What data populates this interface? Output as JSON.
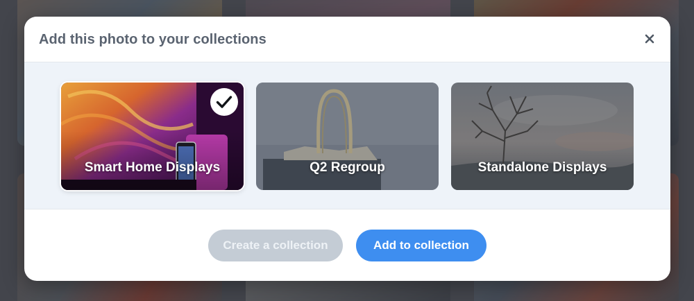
{
  "modal": {
    "title": "Add this photo to your collections",
    "close_icon": "close-icon"
  },
  "collections": [
    {
      "label": "Smart Home Displays",
      "selected": true,
      "icon": "checkmark-icon"
    },
    {
      "label": "Q2 Regroup",
      "selected": false
    },
    {
      "label": "Standalone Displays",
      "selected": false
    }
  ],
  "footer": {
    "create_label": "Create a collection",
    "add_label": "Add to collection"
  },
  "colors": {
    "primary": "#3e8ef0",
    "disabled": "#c4ccd5",
    "title": "#5a6370",
    "body_bg": "#eef3f9"
  }
}
